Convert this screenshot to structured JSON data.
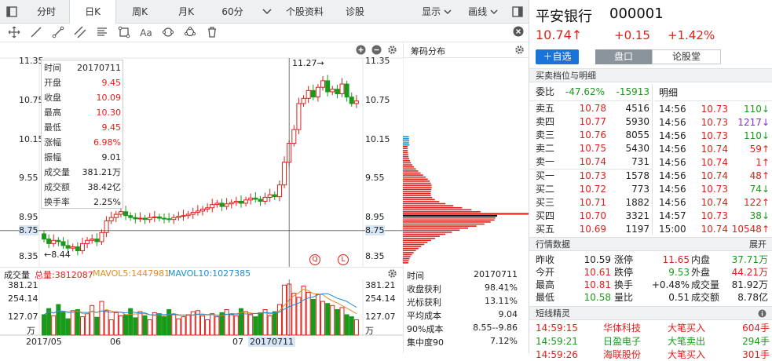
{
  "tabs": [
    {
      "label": "分时",
      "active": false
    },
    {
      "label": "日K",
      "active": true
    },
    {
      "label": "周K",
      "active": false
    },
    {
      "label": "月K",
      "active": false
    },
    {
      "label": "60分",
      "active": false
    },
    {
      "label": "个股资料",
      "active": false
    },
    {
      "label": "诊股",
      "active": false
    },
    {
      "label": "显示",
      "active": false
    },
    {
      "label": "画线",
      "active": false
    }
  ],
  "main_axis": {
    "left": [
      "11.35",
      "10.75",
      "10.15",
      "9.55",
      "8.95",
      "8.75",
      "8.35"
    ],
    "right": [
      "11.35",
      "10.75",
      "10.15",
      "9.55",
      "8.95",
      "8.75",
      "8.35"
    ]
  },
  "annotations": {
    "high": "11.27→",
    "low": "←8.44",
    "marker_q": "Q",
    "marker_l": "L"
  },
  "tooltip": [
    {
      "k": "时间",
      "v": "20170711",
      "c": "dark"
    },
    {
      "k": "开盘",
      "v": "9.45",
      "c": "red"
    },
    {
      "k": "收盘",
      "v": "10.09",
      "c": "red"
    },
    {
      "k": "最高",
      "v": "10.30",
      "c": "red"
    },
    {
      "k": "最低",
      "v": "9.45",
      "c": "red"
    },
    {
      "k": "涨幅",
      "v": "6.98%",
      "c": "red"
    },
    {
      "k": "振幅",
      "v": "9.01",
      "c": "dark"
    },
    {
      "k": "成交量",
      "v": "381.21万",
      "c": "dark"
    },
    {
      "k": "成交额",
      "v": "38.42亿",
      "c": "dark"
    },
    {
      "k": "换手率",
      "v": "2.25%",
      "c": "dark"
    }
  ],
  "chip": {
    "title": "筹码分布"
  },
  "volume": {
    "label": "成交量",
    "total": "总量:3812087",
    "mavol5": "MAVOL5:1447981",
    "mavol10": "MAVOL10:1027385",
    "axis_left": [
      "381.21",
      "254.14",
      "127.07",
      "万"
    ],
    "axis_right": [
      "381.21",
      "254.14",
      "127.07",
      "万"
    ],
    "dates": [
      "2017/05",
      "06",
      "07",
      "20170711"
    ]
  },
  "chip_info": [
    {
      "k": "时间",
      "v": "20170711"
    },
    {
      "k": "收盘获利",
      "v": "98.41%"
    },
    {
      "k": "光标获利",
      "v": "13.11%"
    },
    {
      "k": "平均成本",
      "v": "9.04"
    },
    {
      "k": "90%成本",
      "v": "8.55--9.86"
    },
    {
      "k": "集中度90",
      "v": "7.12%"
    }
  ],
  "stock": {
    "name": "平安银行",
    "code": "000001",
    "price": "10.74↑",
    "change": "+0.15",
    "pct": "+1.42%"
  },
  "buttons": {
    "add": "＋自选",
    "pankou": "盘口",
    "lungu": "论股堂"
  },
  "orderbook": {
    "title": "买卖档位与明细",
    "weibi_k": "委比",
    "weibi_pct": "-47.62%",
    "weibi_v": "-15913",
    "asks": [
      {
        "k": "卖五",
        "p": "10.78",
        "v": "4516"
      },
      {
        "k": "卖四",
        "p": "10.77",
        "v": "5930"
      },
      {
        "k": "卖三",
        "p": "10.76",
        "v": "8055"
      },
      {
        "k": "卖二",
        "p": "10.75",
        "v": "5430"
      },
      {
        "k": "卖一",
        "p": "10.74",
        "v": "731"
      }
    ],
    "bids": [
      {
        "k": "买一",
        "p": "10.73",
        "v": "1578"
      },
      {
        "k": "买二",
        "p": "10.72",
        "v": "773"
      },
      {
        "k": "买三",
        "p": "10.71",
        "v": "1882"
      },
      {
        "k": "买四",
        "p": "10.70",
        "v": "3321"
      },
      {
        "k": "买五",
        "p": "10.69",
        "v": "1197"
      }
    ]
  },
  "trades": {
    "title": "明细",
    "rows": [
      {
        "t": "14:56",
        "p": "10.73",
        "v": "110↓",
        "c": "green"
      },
      {
        "t": "14:56",
        "p": "10.73",
        "v": "1217↓",
        "c": "purple"
      },
      {
        "t": "14:56",
        "p": "10.73",
        "v": "110↓",
        "c": "green"
      },
      {
        "t": "14:56",
        "p": "10.74",
        "v": "59↑",
        "c": "red"
      },
      {
        "t": "14:56",
        "p": "10.74",
        "v": "1↑",
        "c": "red"
      },
      {
        "t": "14:56",
        "p": "10.74",
        "v": "48↑",
        "c": "red"
      },
      {
        "t": "14:56",
        "p": "10.73",
        "v": "74↓",
        "c": "green"
      },
      {
        "t": "14:56",
        "p": "10.74",
        "v": "122↑",
        "c": "red"
      },
      {
        "t": "14:57",
        "p": "10.73",
        "v": "38↓",
        "c": "green"
      },
      {
        "t": "15:00",
        "p": "10.74",
        "v": "10548↑",
        "c": "red"
      }
    ]
  },
  "stats": {
    "title": "行情数据",
    "expand": "展开",
    "rows": [
      [
        {
          "t": "昨收",
          "c": "dark"
        },
        {
          "t": "10.59",
          "c": "dark"
        },
        {
          "t": "涨停",
          "c": "dark"
        },
        {
          "t": "11.65",
          "c": "red"
        },
        {
          "t": "内盘",
          "c": "dark"
        },
        {
          "t": "37.71万",
          "c": "green"
        }
      ],
      [
        {
          "t": "今开",
          "c": "dark"
        },
        {
          "t": "10.61",
          "c": "red"
        },
        {
          "t": "跌停",
          "c": "dark"
        },
        {
          "t": "9.53",
          "c": "green"
        },
        {
          "t": "外盘",
          "c": "dark"
        },
        {
          "t": "44.21万",
          "c": "red"
        }
      ],
      [
        {
          "t": "最高",
          "c": "dark"
        },
        {
          "t": "10.81",
          "c": "red"
        },
        {
          "t": "换手",
          "c": "dark"
        },
        {
          "t": "+0.48%",
          "c": "dark"
        },
        {
          "t": "成交量",
          "c": "dark"
        },
        {
          "t": "81.92万",
          "c": "dark"
        }
      ],
      [
        {
          "t": "最低",
          "c": "dark"
        },
        {
          "t": "10.58",
          "c": "green"
        },
        {
          "t": "量比",
          "c": "dark"
        },
        {
          "t": "0.51",
          "c": "dark"
        },
        {
          "t": "成交额",
          "c": "dark"
        },
        {
          "t": "8.78亿",
          "c": "dark"
        }
      ]
    ]
  },
  "sprite": {
    "title": "短线精灵",
    "rows": [
      {
        "t": "14:59:15",
        "n": "华体科技",
        "a": "大笔买入",
        "v": "604手",
        "c": "red"
      },
      {
        "t": "14:59:21",
        "n": "日盈电子",
        "a": "大笔卖出",
        "v": "294手",
        "c": "green"
      },
      {
        "t": "14:59:26",
        "n": "海联股份",
        "a": "大笔买入",
        "v": "301手",
        "c": "red"
      }
    ]
  },
  "colors": {
    "up": "#e0201b",
    "down": "#1a9a1a",
    "blue": "#1a73d9",
    "purple": "#8a2be2"
  }
}
